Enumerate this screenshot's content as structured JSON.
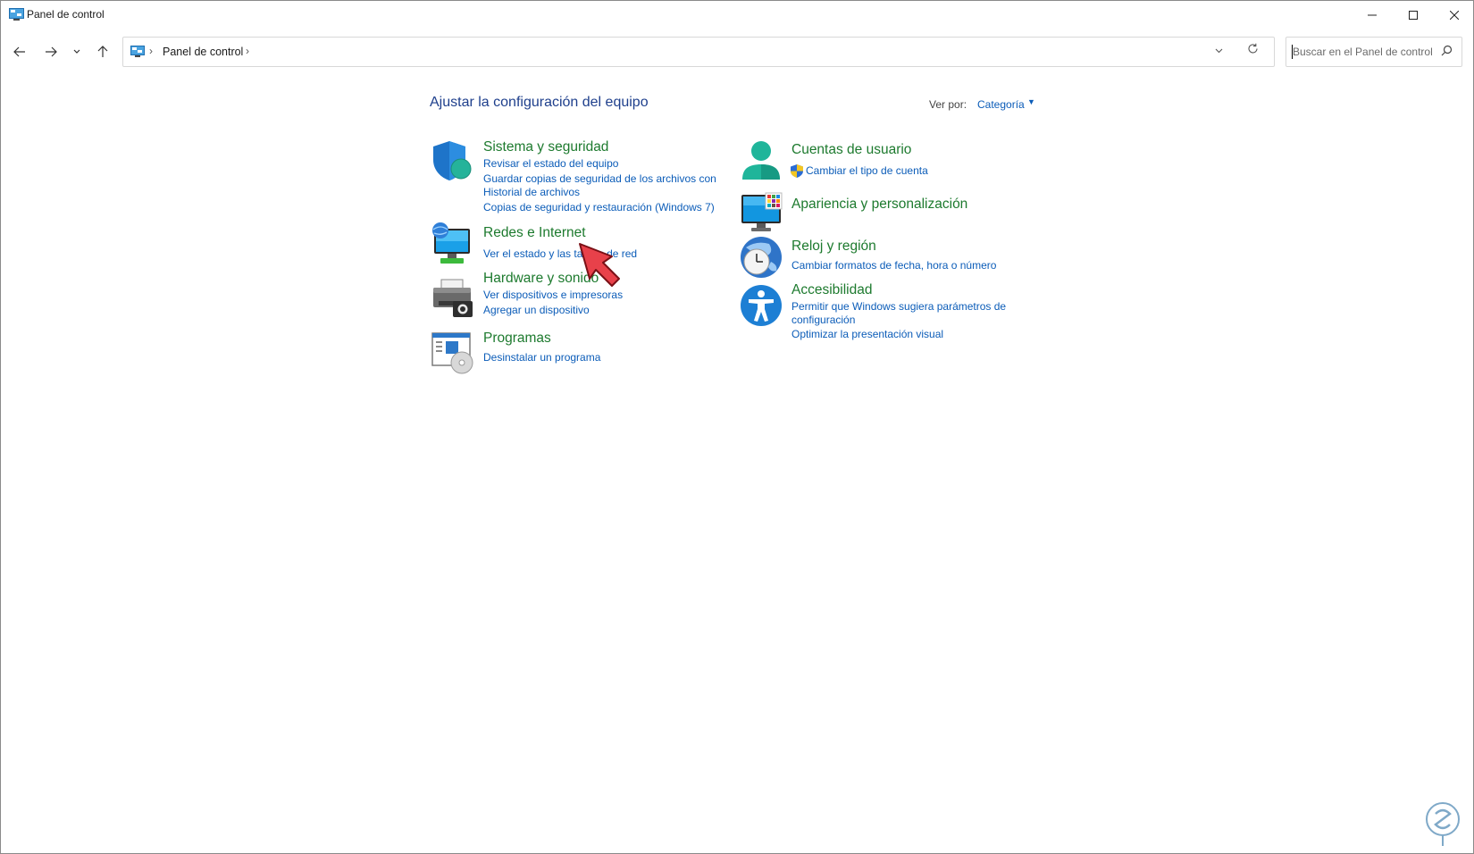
{
  "window": {
    "title": "Panel de control",
    "minimize_icon": "minimize-icon",
    "maximize_icon": "maximize-icon",
    "close_icon": "close-icon"
  },
  "nav": {
    "back_icon": "back-arrow-icon",
    "forward_icon": "forward-arrow-icon",
    "recent_icon": "chevron-down-icon",
    "up_icon": "up-arrow-icon"
  },
  "address": {
    "path": "Panel de control",
    "separator": "›"
  },
  "search": {
    "placeholder": "Buscar en el Panel de control"
  },
  "main": {
    "heading": "Ajustar la configuración del equipo",
    "view_by_label": "Ver por:",
    "view_by_value": "Categoría"
  },
  "categories": {
    "sistema": {
      "title": "Sistema y seguridad",
      "icon": "shield-icon",
      "links": [
        "Revisar el estado del equipo",
        "Guardar copias de seguridad de los archivos con",
        "Historial de archivos",
        "Copias de seguridad y restauración (Windows 7)"
      ]
    },
    "redes": {
      "title": "Redes e Internet",
      "icon": "network-monitor-icon",
      "links": [
        "Ver el estado y las tareas de red"
      ]
    },
    "hardware": {
      "title": "Hardware y sonido",
      "icon": "printer-icon",
      "links": [
        "Ver dispositivos e impresoras",
        "Agregar un dispositivo"
      ]
    },
    "programas": {
      "title": "Programas",
      "icon": "programs-disc-icon",
      "links": [
        "Desinstalar un programa"
      ]
    },
    "cuentas": {
      "title": "Cuentas de usuario",
      "icon": "user-icon",
      "links": [
        "Cambiar el tipo de cuenta"
      ],
      "link_icon": "uac-shield-icon"
    },
    "apariencia": {
      "title": "Apariencia y personalización",
      "icon": "monitor-palette-icon",
      "links": []
    },
    "reloj": {
      "title": "Reloj y región",
      "icon": "clock-globe-icon",
      "links": [
        "Cambiar formatos de fecha, hora o número"
      ]
    },
    "accesibilidad": {
      "title": "Accesibilidad",
      "icon": "accessibility-icon",
      "links": [
        "Permitir que Windows sugiera parámetros de",
        "configuración",
        "Optimizar la presentación visual"
      ]
    }
  },
  "overlay": {
    "pointer_icon": "red-arrow-pointer-icon",
    "watermark_icon": "watermark-logo-icon"
  },
  "colors": {
    "title_green": "#1d7a2e",
    "link_blue": "#0b5cb8",
    "heading_blue": "#1e3f8c",
    "pointer_red": "#e8414a"
  }
}
